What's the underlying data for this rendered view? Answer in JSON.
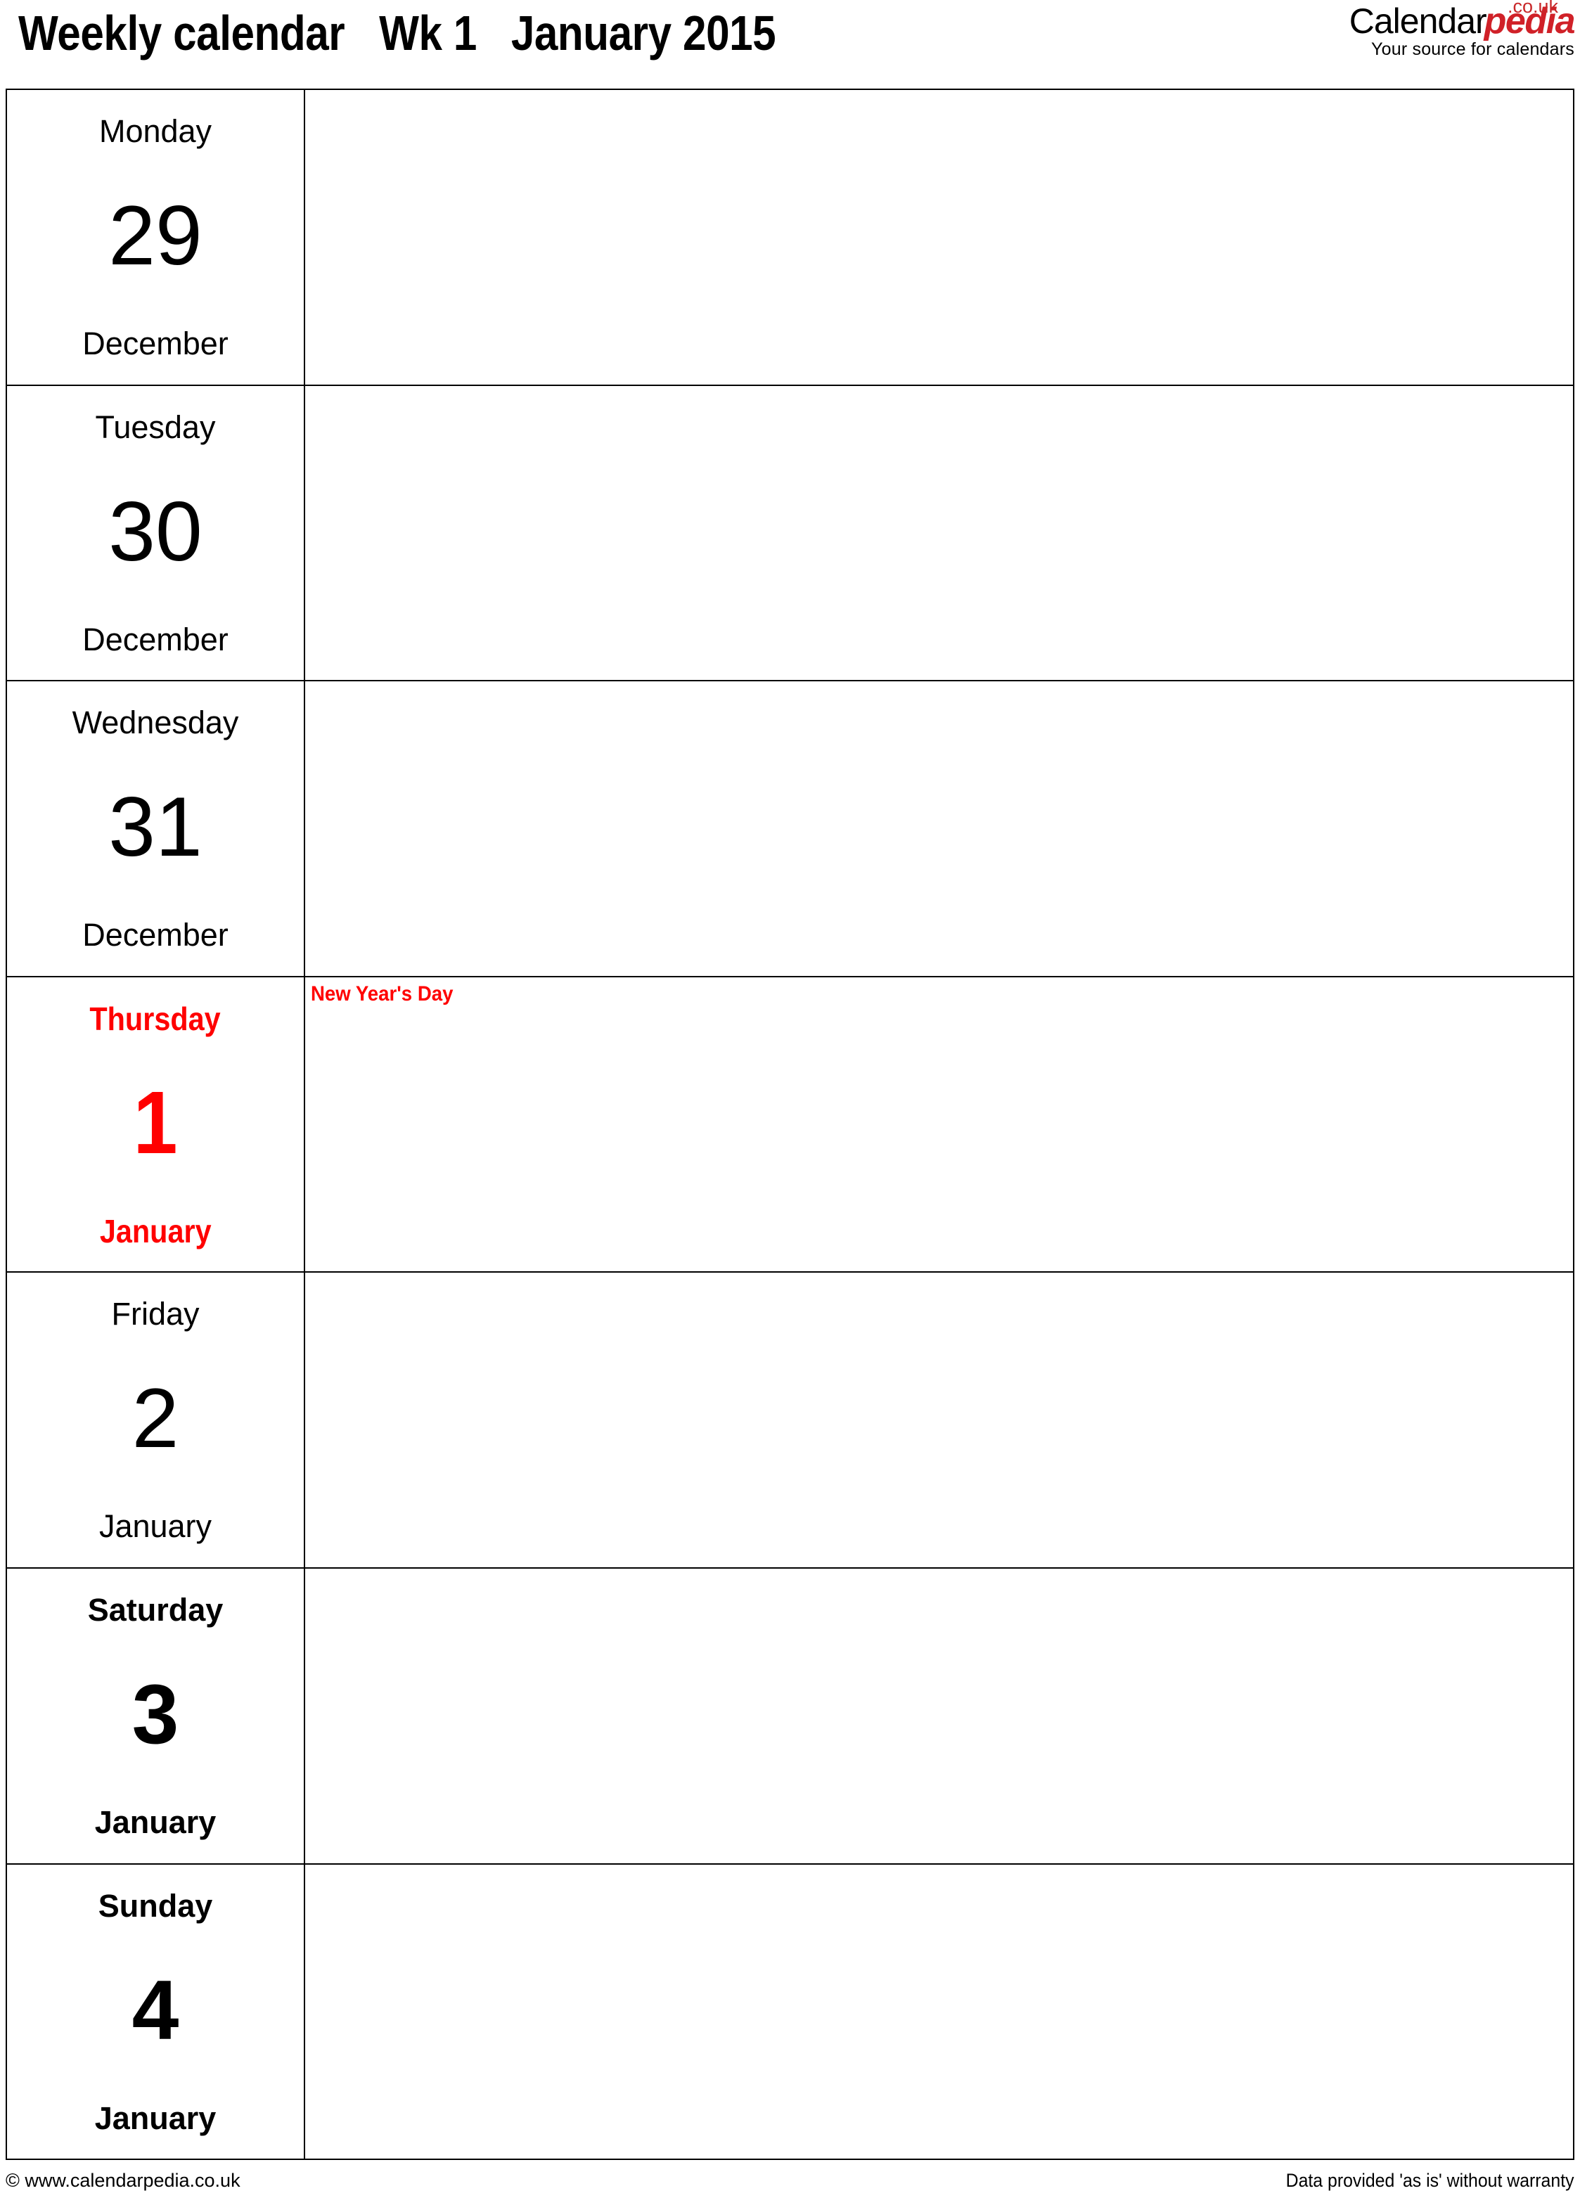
{
  "header": {
    "title": "Weekly calendar   Wk 1   January 2015",
    "logo": {
      "brand_first": "Calendar",
      "brand_second": "pedia",
      "tld": ".co.uk",
      "tagline": "Your source for calendars",
      "brand_color": "#d02128",
      "tld_color": "#c8282a"
    }
  },
  "calendar": {
    "holiday_color": "#ff0000",
    "days": [
      {
        "dayname": "Monday",
        "daynum": "29",
        "monthname": "December",
        "style": "regular",
        "events": []
      },
      {
        "dayname": "Tuesday",
        "daynum": "30",
        "monthname": "December",
        "style": "regular",
        "events": []
      },
      {
        "dayname": "Wednesday",
        "daynum": "31",
        "monthname": "December",
        "style": "regular",
        "events": []
      },
      {
        "dayname": "Thursday",
        "daynum": "1",
        "monthname": "January",
        "style": "holiday",
        "events": [
          "New Year's Day"
        ]
      },
      {
        "dayname": "Friday",
        "daynum": "2",
        "monthname": "January",
        "style": "regular",
        "events": []
      },
      {
        "dayname": "Saturday",
        "daynum": "3",
        "monthname": "January",
        "style": "bold",
        "events": []
      },
      {
        "dayname": "Sunday",
        "daynum": "4",
        "monthname": "January",
        "style": "bold",
        "events": []
      }
    ]
  },
  "footer": {
    "copyright": "© www.calendarpedia.co.uk",
    "disclaimer": "Data provided 'as is' without warranty"
  }
}
